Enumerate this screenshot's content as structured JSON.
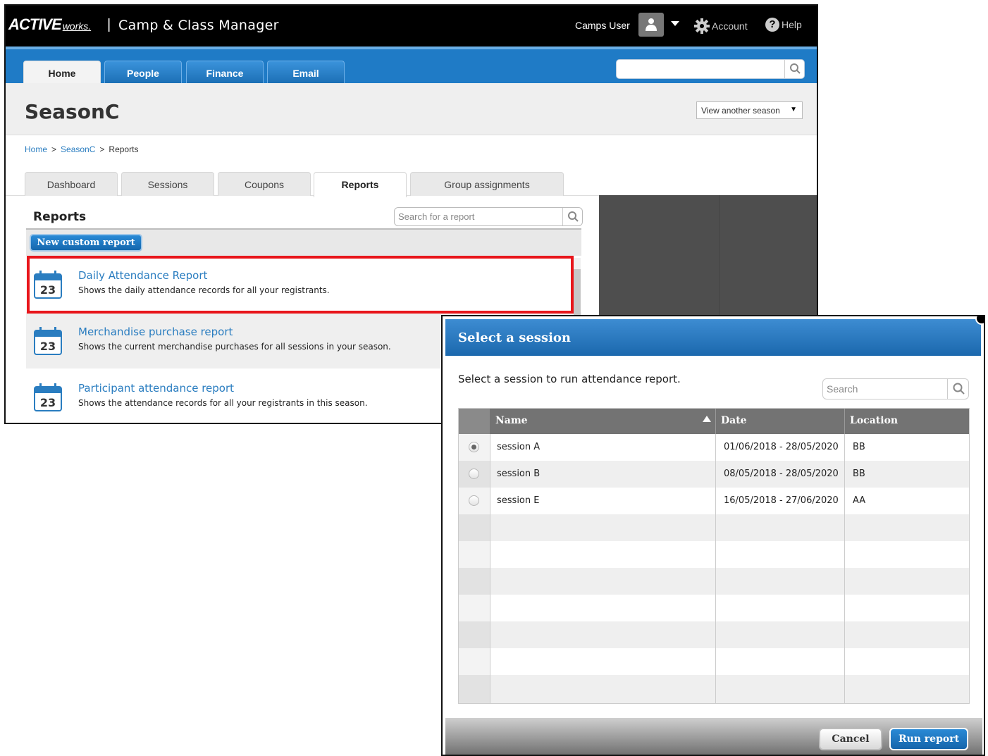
{
  "app": {
    "logo_main": "ACTIVE",
    "logo_sub": "works.",
    "logo_separator": "|",
    "title": "Camp & Class Manager",
    "user_name": "Camps User",
    "account_label": "Account",
    "help_label": "Help"
  },
  "nav": {
    "tabs": [
      {
        "label": "Home",
        "active": true
      },
      {
        "label": "People"
      },
      {
        "label": "Finance"
      },
      {
        "label": "Email"
      }
    ],
    "search_value": ""
  },
  "season": {
    "title": "SeasonC",
    "selector_label": "View another season"
  },
  "breadcrumb": [
    {
      "label": "Home",
      "link": true
    },
    {
      "label": "SeasonC",
      "link": true
    },
    {
      "label": "Reports",
      "link": false
    }
  ],
  "breadcrumb_separator": ">",
  "subtabs": [
    {
      "label": "Dashboard"
    },
    {
      "label": "Sessions"
    },
    {
      "label": "Coupons"
    },
    {
      "label": "Reports",
      "active": true
    },
    {
      "label": "Group assignments"
    }
  ],
  "reports": {
    "heading": "Reports",
    "search_placeholder": "Search for a report",
    "new_button": "New custom report",
    "icon_day": "23",
    "items": [
      {
        "title": "Daily Attendance Report",
        "description": "Shows the daily attendance records for all your registrants.",
        "highlighted": true
      },
      {
        "title": "Merchandise purchase report",
        "description": "Shows the current merchandise purchases for all sessions in your season."
      },
      {
        "title": "Participant attendance report",
        "description": "Shows the attendance records for all your registrants in this season."
      }
    ]
  },
  "dialog": {
    "title": "Select a session",
    "intro": "Select a session to run attendance report.",
    "search_placeholder": "Search",
    "columns": {
      "name": "Name",
      "date": "Date",
      "location": "Location"
    },
    "sessions": [
      {
        "name": "session A",
        "date": "01/06/2018 - 28/05/2020",
        "location": "BB",
        "selected": true
      },
      {
        "name": "session B",
        "date": "08/05/2018 - 28/05/2020",
        "location": "BB",
        "selected": false
      },
      {
        "name": "session E",
        "date": "16/05/2018 - 27/06/2020",
        "location": "AA",
        "selected": false
      }
    ],
    "cancel_label": "Cancel",
    "run_label": "Run report"
  },
  "colors": {
    "brand_blue": "#1f7bc6",
    "link_blue": "#2a7dc0",
    "highlight_red": "#e8161b"
  }
}
